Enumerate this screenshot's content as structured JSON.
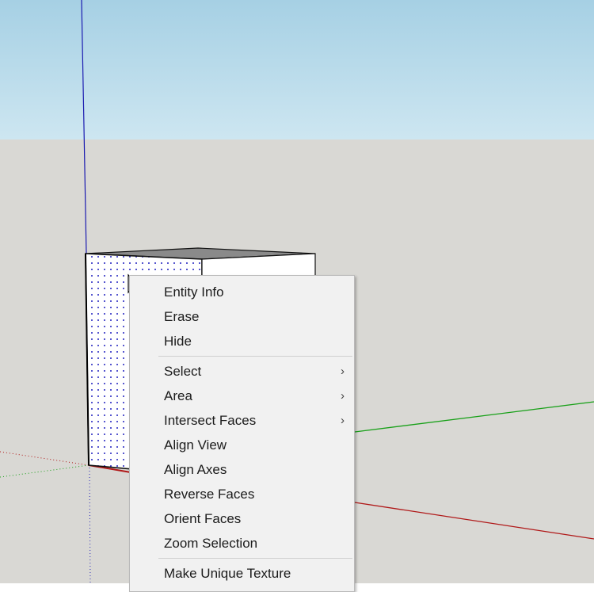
{
  "colors": {
    "sky_top": "#a6d0e4",
    "sky_bottom": "#cde6f1",
    "ground": "#d9d8d4",
    "axis_blue": "#1a1ab0",
    "axis_red": "#b01818",
    "axis_green": "#18a018",
    "menu_bg": "#f1f1f1"
  },
  "context_menu": {
    "items": [
      {
        "label": "Entity Info",
        "submenu": false
      },
      {
        "label": "Erase",
        "submenu": false
      },
      {
        "label": "Hide",
        "submenu": false
      },
      {
        "label": "Select",
        "submenu": true
      },
      {
        "label": "Area",
        "submenu": true
      },
      {
        "label": "Intersect Faces",
        "submenu": true
      },
      {
        "label": "Align View",
        "submenu": false
      },
      {
        "label": "Align Axes",
        "submenu": false
      },
      {
        "label": "Reverse Faces",
        "submenu": false
      },
      {
        "label": "Orient Faces",
        "submenu": false
      },
      {
        "label": "Zoom Selection",
        "submenu": false
      },
      {
        "label": "Make Unique Texture",
        "submenu": false
      }
    ],
    "submenu_glyph": "›"
  }
}
